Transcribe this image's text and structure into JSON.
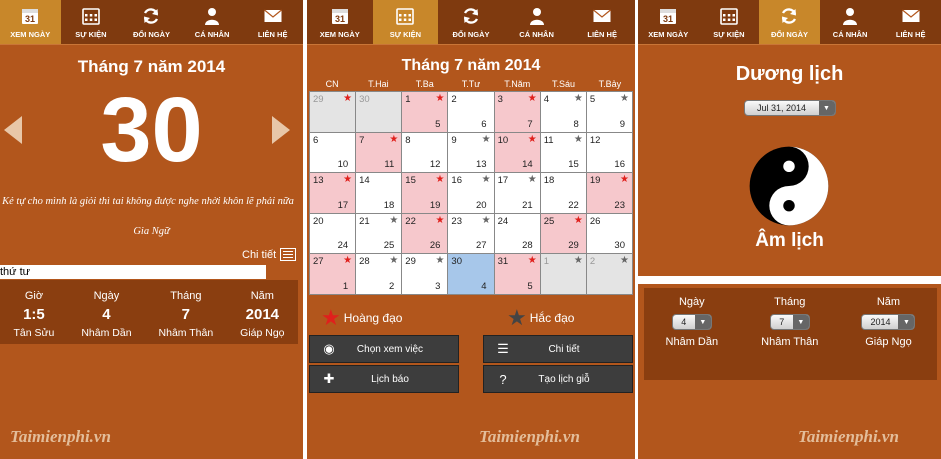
{
  "nav": [
    "XEM NGÀY",
    "SỰ KIỆN",
    "ĐỔI NGÀY",
    "CÁ NHÂN",
    "LIÊN HỆ"
  ],
  "cal_icon_number": "31",
  "watermark": "Taimienphi.vn",
  "colors": {
    "panel_bg": "#b2561c",
    "nav_bg": "#7f3a0f",
    "nav_active": "#c8872a",
    "box_bg": "#8a3e10",
    "good_day_pink": "#f6c8cc",
    "today_blue": "#a7c7ea"
  },
  "screen1": {
    "month_title": "Tháng 7 năm 2014",
    "day": "30",
    "quote": "Kẻ tự cho mình là giỏi thì tai không được nghe nhời khôn lẽ phải nữa",
    "author": "Gia Ngữ",
    "detail_label": "Chi tiết",
    "weekday": "thứ tư",
    "info": [
      {
        "header": "Giờ",
        "value": "1:5",
        "canchi": "Tân Sửu"
      },
      {
        "header": "Ngày",
        "value": "4",
        "canchi": "Nhâm Dần"
      },
      {
        "header": "Tháng",
        "value": "7",
        "canchi": "Nhâm Thân"
      },
      {
        "header": "Năm",
        "value": "2014",
        "canchi": "Giáp Ngọ"
      }
    ]
  },
  "screen2": {
    "month_title": "Tháng 7 năm 2014",
    "weekdays": [
      "CN",
      "T.Hai",
      "T.Ba",
      "T.Tư",
      "T.Năm",
      "T.Sáu",
      "T.Bảy"
    ],
    "cells": [
      {
        "d": "29",
        "l": "",
        "s": "red",
        "t": "other"
      },
      {
        "d": "30",
        "l": "",
        "s": "",
        "t": "other"
      },
      {
        "d": "1",
        "l": "5",
        "s": "red",
        "t": "pink"
      },
      {
        "d": "2",
        "l": "6",
        "s": "",
        "t": ""
      },
      {
        "d": "3",
        "l": "7",
        "s": "red",
        "t": "pink"
      },
      {
        "d": "4",
        "l": "8",
        "s": "gray",
        "t": ""
      },
      {
        "d": "5",
        "l": "9",
        "s": "gray",
        "t": ""
      },
      {
        "d": "6",
        "l": "10",
        "s": "",
        "t": ""
      },
      {
        "d": "7",
        "l": "11",
        "s": "red",
        "t": "pink"
      },
      {
        "d": "8",
        "l": "12",
        "s": "",
        "t": ""
      },
      {
        "d": "9",
        "l": "13",
        "s": "gray",
        "t": ""
      },
      {
        "d": "10",
        "l": "14",
        "s": "red",
        "t": "pink"
      },
      {
        "d": "11",
        "l": "15",
        "s": "gray",
        "t": ""
      },
      {
        "d": "12",
        "l": "16",
        "s": "",
        "t": ""
      },
      {
        "d": "13",
        "l": "17",
        "s": "red",
        "t": "pink"
      },
      {
        "d": "14",
        "l": "18",
        "s": "",
        "t": ""
      },
      {
        "d": "15",
        "l": "19",
        "s": "red",
        "t": "pink"
      },
      {
        "d": "16",
        "l": "20",
        "s": "gray",
        "t": ""
      },
      {
        "d": "17",
        "l": "21",
        "s": "gray",
        "t": ""
      },
      {
        "d": "18",
        "l": "22",
        "s": "",
        "t": ""
      },
      {
        "d": "19",
        "l": "23",
        "s": "red",
        "t": "pink"
      },
      {
        "d": "20",
        "l": "24",
        "s": "",
        "t": ""
      },
      {
        "d": "21",
        "l": "25",
        "s": "gray",
        "t": ""
      },
      {
        "d": "22",
        "l": "26",
        "s": "red",
        "t": "pink"
      },
      {
        "d": "23",
        "l": "27",
        "s": "gray",
        "t": ""
      },
      {
        "d": "24",
        "l": "28",
        "s": "",
        "t": ""
      },
      {
        "d": "25",
        "l": "29",
        "s": "red",
        "t": "pink"
      },
      {
        "d": "26",
        "l": "30",
        "s": "",
        "t": ""
      },
      {
        "d": "27",
        "l": "1",
        "s": "red",
        "t": "pink"
      },
      {
        "d": "28",
        "l": "2",
        "s": "gray",
        "t": ""
      },
      {
        "d": "29",
        "l": "3",
        "s": "gray",
        "t": ""
      },
      {
        "d": "30",
        "l": "4",
        "s": "",
        "t": "today"
      },
      {
        "d": "31",
        "l": "5",
        "s": "red",
        "t": "pink"
      },
      {
        "d": "1",
        "l": "",
        "s": "gray",
        "t": "other"
      },
      {
        "d": "2",
        "l": "",
        "s": "gray",
        "t": "other"
      }
    ],
    "legend_good": "Hoàng đạo",
    "legend_bad": "Hắc đạo",
    "buttons": [
      "Chọn xem việc",
      "Chi tiết",
      "Lịch báo",
      "Tạo lịch giỗ"
    ]
  },
  "screen3": {
    "solar_title": "Dương lịch",
    "solar_date": "Jul 31, 2014",
    "lunar_title": "Âm lịch",
    "lunar": [
      {
        "header": "Ngày",
        "value": "4",
        "canchi": "Nhâm Dần"
      },
      {
        "header": "Tháng",
        "value": "7",
        "canchi": "Nhâm Thân"
      },
      {
        "header": "Năm",
        "value": "2014",
        "canchi": "Giáp Ngọ"
      }
    ]
  }
}
